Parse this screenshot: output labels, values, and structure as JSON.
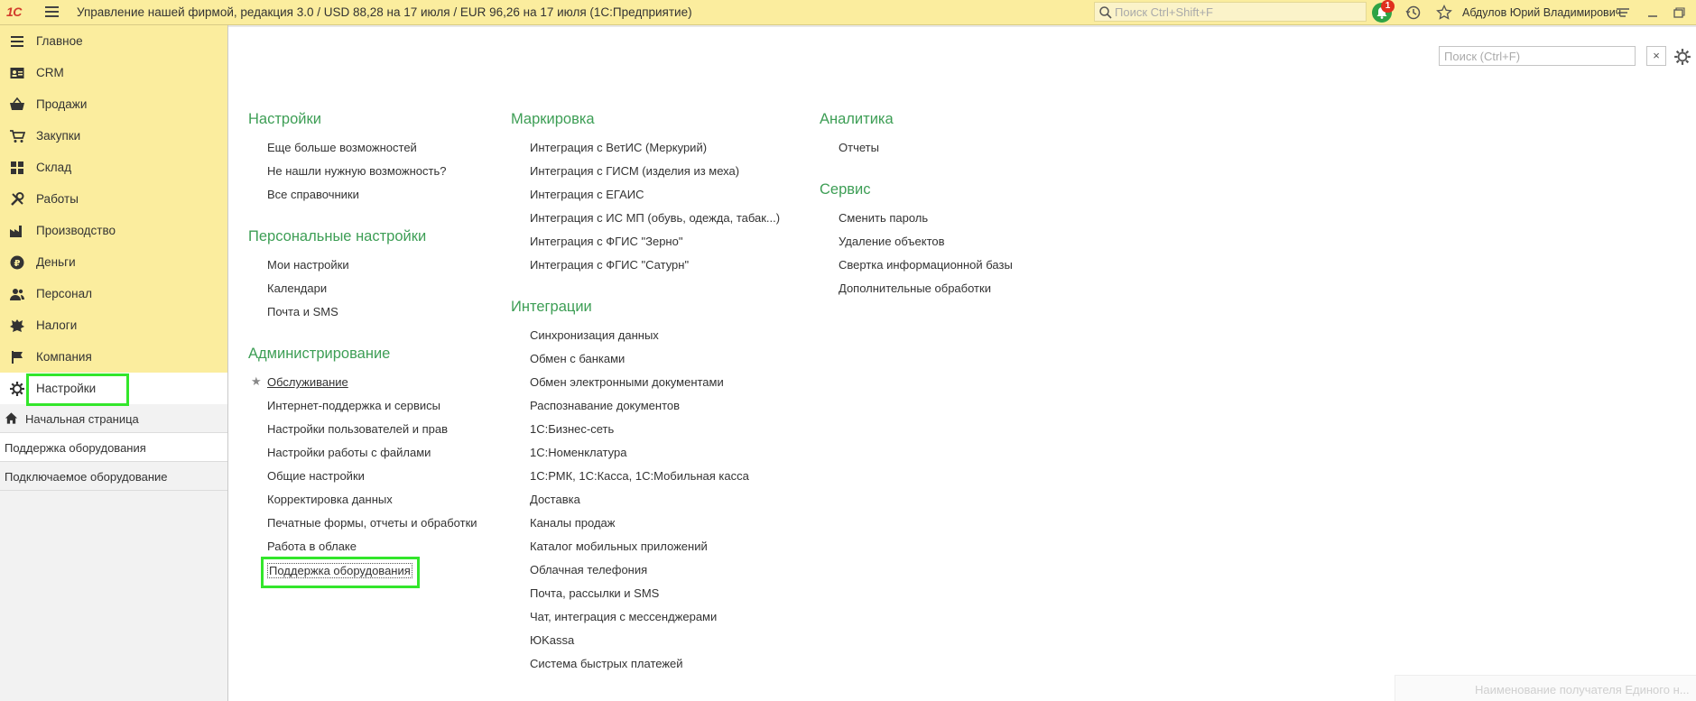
{
  "topbar": {
    "logo": "1С",
    "title": "Управление нашей фирмой, редакция 3.0 / USD 88,28 на 17 июля / EUR 96,26 на 17 июля  (1С:Предприятие)",
    "search_placeholder": "Поиск Ctrl+Shift+F",
    "notification_count": "1",
    "user_name": "Абдулов Юрий Владимирович"
  },
  "sidebar": {
    "sections": [
      {
        "label": "Главное",
        "icon": "menu-lines-icon"
      },
      {
        "label": "CRM",
        "icon": "contact-card-icon"
      },
      {
        "label": "Продажи",
        "icon": "basket-icon"
      },
      {
        "label": "Закупки",
        "icon": "cart-icon"
      },
      {
        "label": "Склад",
        "icon": "warehouse-grid-icon"
      },
      {
        "label": "Работы",
        "icon": "tools-icon"
      },
      {
        "label": "Производство",
        "icon": "factory-icon"
      },
      {
        "label": "Деньги",
        "icon": "coin-icon"
      },
      {
        "label": "Персонал",
        "icon": "people-icon"
      },
      {
        "label": "Налоги",
        "icon": "emblem-icon"
      },
      {
        "label": "Компания",
        "icon": "flag-icon"
      },
      {
        "label": "Настройки",
        "icon": "gear-icon"
      }
    ],
    "active_section": "Настройки",
    "open_pages": [
      {
        "label": "Начальная страница",
        "icon": "home-icon"
      },
      {
        "label": "Поддержка оборудования"
      },
      {
        "label": "Подключаемое оборудование"
      }
    ]
  },
  "main": {
    "search_placeholder": "Поиск (Ctrl+F)",
    "clear_label": "×",
    "columns": [
      {
        "groups": [
          {
            "title": "Настройки",
            "items": [
              "Еще больше возможностей",
              "Не нашли нужную возможность?",
              "Все справочники"
            ]
          },
          {
            "title": "Персональные настройки",
            "items": [
              "Мои настройки",
              "Календари",
              "Почта и SMS"
            ]
          },
          {
            "title": "Администрирование",
            "items": [
              "Обслуживание",
              "Интернет-поддержка и сервисы",
              "Настройки пользователей и прав",
              "Настройки работы с файлами",
              "Общие настройки",
              "Корректировка данных",
              "Печатные формы, отчеты и обработки",
              "Работа в облаке",
              "Поддержка оборудования"
            ]
          }
        ]
      },
      {
        "groups": [
          {
            "title": "Маркировка",
            "items": [
              "Интеграция с ВетИС (Меркурий)",
              "Интеграция с ГИСМ (изделия из меха)",
              "Интеграция с ЕГАИС",
              "Интеграция с ИС МП (обувь, одежда, табак...)",
              "Интеграция с ФГИС \"Зерно\"",
              "Интеграция с ФГИС \"Сатурн\""
            ]
          },
          {
            "title": "Интеграции",
            "items": [
              "Синхронизация данных",
              "Обмен с банками",
              "Обмен электронными документами",
              "Распознавание документов",
              "1С:Бизнес-сеть",
              "1С:Номенклатура",
              "1С:РМК, 1С:Касса, 1С:Мобильная касса",
              "Доставка",
              "Каналы продаж",
              "Каталог мобильных приложений",
              "Облачная телефония",
              "Почта, рассылки и SMS",
              "Чат, интеграция с мессенджерами",
              "ЮKassa",
              "Система быстрых платежей"
            ]
          }
        ]
      },
      {
        "groups": [
          {
            "title": "Аналитика",
            "items": [
              "Отчеты"
            ]
          },
          {
            "title": "Сервис",
            "items": [
              "Сменить пароль",
              "Удаление объектов",
              "Свертка информационной базы",
              "Дополнительные обработки"
            ]
          }
        ]
      }
    ],
    "favorite_item": "Обслуживание",
    "bottom_hint": "Наименование получателя Единого н..."
  },
  "colors": {
    "accent_green": "#3d9e55",
    "panel_yellow": "#fbed9e",
    "highlight": "#33e62b"
  }
}
